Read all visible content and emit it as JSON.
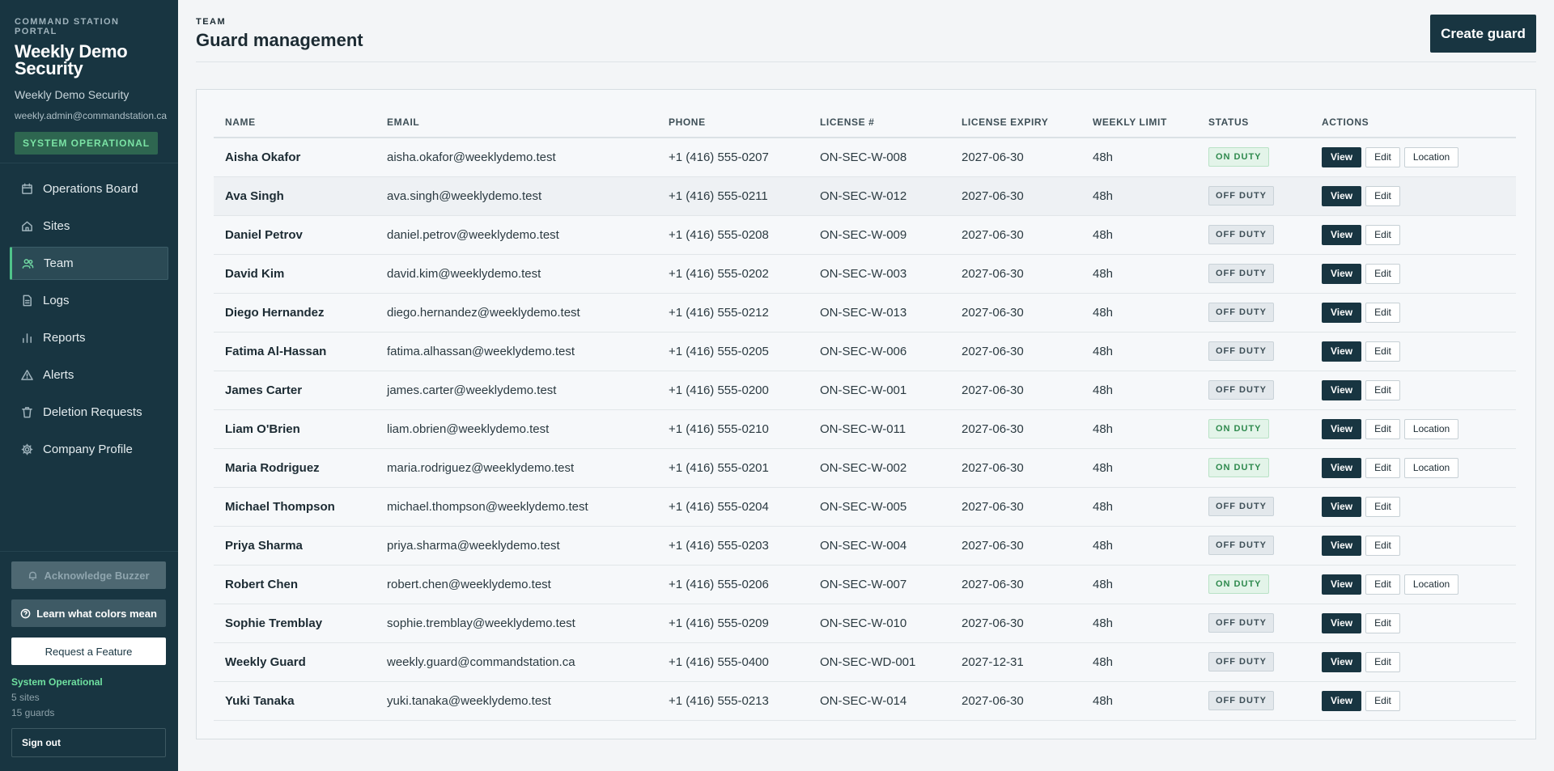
{
  "sidebar": {
    "eyebrow": "COMMAND STATION PORTAL",
    "title": "Weekly Demo Security",
    "subtitle": "Weekly Demo Security",
    "email": "weekly.admin@commandstation.ca",
    "system_badge": "SYSTEM OPERATIONAL",
    "nav": [
      {
        "label": "Operations Board",
        "icon": "calendar-icon"
      },
      {
        "label": "Sites",
        "icon": "home-icon"
      },
      {
        "label": "Team",
        "icon": "users-icon",
        "active": true
      },
      {
        "label": "Logs",
        "icon": "document-icon"
      },
      {
        "label": "Reports",
        "icon": "bar-chart-icon"
      },
      {
        "label": "Alerts",
        "icon": "warning-icon"
      },
      {
        "label": "Deletion Requests",
        "icon": "trash-icon"
      },
      {
        "label": "Company Profile",
        "icon": "gear-icon"
      }
    ],
    "acknowledge_label": "Acknowledge Buzzer",
    "learn_label": "Learn what colors mean",
    "request_label": "Request a Feature",
    "status_text": "System Operational",
    "sites_text": "5 sites",
    "guards_text": "15 guards",
    "signout_label": "Sign out"
  },
  "header": {
    "eyebrow": "TEAM",
    "title": "Guard management",
    "create_label": "Create guard"
  },
  "table": {
    "columns": [
      "NAME",
      "EMAIL",
      "PHONE",
      "LICENSE #",
      "LICENSE EXPIRY",
      "WEEKLY LIMIT",
      "STATUS",
      "ACTIONS"
    ],
    "rows": [
      {
        "name": "Aisha Okafor",
        "email": "aisha.okafor@weeklydemo.test",
        "phone": "+1 (416) 555-0207",
        "license": "ON-SEC-W-008",
        "expiry": "2027-06-30",
        "limit": "48h",
        "status": "ON DUTY"
      },
      {
        "name": "Ava Singh",
        "email": "ava.singh@weeklydemo.test",
        "phone": "+1 (416) 555-0211",
        "license": "ON-SEC-W-012",
        "expiry": "2027-06-30",
        "limit": "48h",
        "status": "OFF DUTY"
      },
      {
        "name": "Daniel Petrov",
        "email": "daniel.petrov@weeklydemo.test",
        "phone": "+1 (416) 555-0208",
        "license": "ON-SEC-W-009",
        "expiry": "2027-06-30",
        "limit": "48h",
        "status": "OFF DUTY"
      },
      {
        "name": "David Kim",
        "email": "david.kim@weeklydemo.test",
        "phone": "+1 (416) 555-0202",
        "license": "ON-SEC-W-003",
        "expiry": "2027-06-30",
        "limit": "48h",
        "status": "OFF DUTY"
      },
      {
        "name": "Diego Hernandez",
        "email": "diego.hernandez@weeklydemo.test",
        "phone": "+1 (416) 555-0212",
        "license": "ON-SEC-W-013",
        "expiry": "2027-06-30",
        "limit": "48h",
        "status": "OFF DUTY"
      },
      {
        "name": "Fatima Al-Hassan",
        "email": "fatima.alhassan@weeklydemo.test",
        "phone": "+1 (416) 555-0205",
        "license": "ON-SEC-W-006",
        "expiry": "2027-06-30",
        "limit": "48h",
        "status": "OFF DUTY"
      },
      {
        "name": "James Carter",
        "email": "james.carter@weeklydemo.test",
        "phone": "+1 (416) 555-0200",
        "license": "ON-SEC-W-001",
        "expiry": "2027-06-30",
        "limit": "48h",
        "status": "OFF DUTY"
      },
      {
        "name": "Liam O'Brien",
        "email": "liam.obrien@weeklydemo.test",
        "phone": "+1 (416) 555-0210",
        "license": "ON-SEC-W-011",
        "expiry": "2027-06-30",
        "limit": "48h",
        "status": "ON DUTY"
      },
      {
        "name": "Maria Rodriguez",
        "email": "maria.rodriguez@weeklydemo.test",
        "phone": "+1 (416) 555-0201",
        "license": "ON-SEC-W-002",
        "expiry": "2027-06-30",
        "limit": "48h",
        "status": "ON DUTY"
      },
      {
        "name": "Michael Thompson",
        "email": "michael.thompson@weeklydemo.test",
        "phone": "+1 (416) 555-0204",
        "license": "ON-SEC-W-005",
        "expiry": "2027-06-30",
        "limit": "48h",
        "status": "OFF DUTY"
      },
      {
        "name": "Priya Sharma",
        "email": "priya.sharma@weeklydemo.test",
        "phone": "+1 (416) 555-0203",
        "license": "ON-SEC-W-004",
        "expiry": "2027-06-30",
        "limit": "48h",
        "status": "OFF DUTY"
      },
      {
        "name": "Robert Chen",
        "email": "robert.chen@weeklydemo.test",
        "phone": "+1 (416) 555-0206",
        "license": "ON-SEC-W-007",
        "expiry": "2027-06-30",
        "limit": "48h",
        "status": "ON DUTY"
      },
      {
        "name": "Sophie Tremblay",
        "email": "sophie.tremblay@weeklydemo.test",
        "phone": "+1 (416) 555-0209",
        "license": "ON-SEC-W-010",
        "expiry": "2027-06-30",
        "limit": "48h",
        "status": "OFF DUTY"
      },
      {
        "name": "Weekly Guard",
        "email": "weekly.guard@commandstation.ca",
        "phone": "+1 (416) 555-0400",
        "license": "ON-SEC-WD-001",
        "expiry": "2027-12-31",
        "limit": "48h",
        "status": "OFF DUTY"
      },
      {
        "name": "Yuki Tanaka",
        "email": "yuki.tanaka@weeklydemo.test",
        "phone": "+1 (416) 555-0213",
        "license": "ON-SEC-W-014",
        "expiry": "2027-06-30",
        "limit": "48h",
        "status": "OFF DUTY"
      }
    ],
    "actions": {
      "view": "View",
      "edit": "Edit",
      "location": "Location"
    }
  },
  "colors": {
    "sidebar_bg": "#183541",
    "accent_green": "#4fc38a",
    "primary_button": "#183541",
    "on_duty": "#2f8a4e"
  }
}
